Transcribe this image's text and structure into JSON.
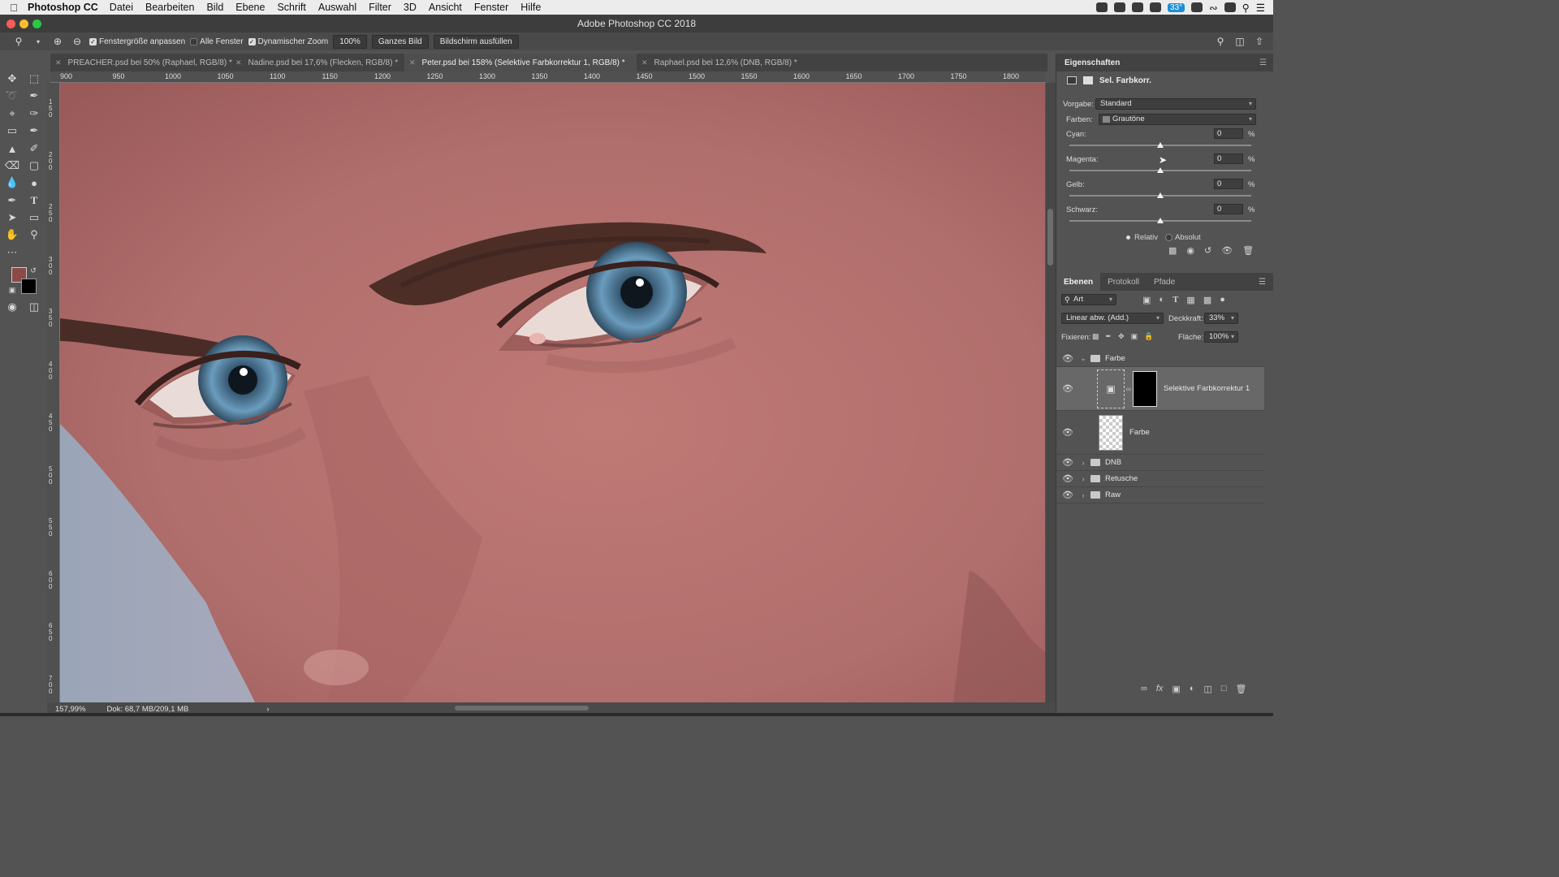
{
  "menubar": {
    "app_name": "Photoshop CC",
    "items": [
      "Datei",
      "Bearbeiten",
      "Bild",
      "Ebene",
      "Schrift",
      "Auswahl",
      "Filter",
      "3D",
      "Ansicht",
      "Fenster",
      "Hilfe"
    ],
    "battery_badge": "33°"
  },
  "window": {
    "title": "Adobe Photoshop CC 2018"
  },
  "options": {
    "resize_windows": "Fenstergröße anpassen",
    "all_windows": "Alle Fenster",
    "scrubby_zoom": "Dynamischer Zoom",
    "zoom_100": "100%",
    "fit_screen": "Ganzes Bild",
    "fill_screen": "Bildschirm ausfüllen"
  },
  "tabs": [
    {
      "label": "PREACHER.psd bei 50% (Raphael, RGB/8) *"
    },
    {
      "label": "Nadine.psd bei 17,6% (Flecken, RGB/8) *"
    },
    {
      "label": "Peter.psd bei 158% (Selektive Farbkorrektur 1, RGB/8) *"
    },
    {
      "label": "Raphael.psd bei 12,6% (DNB, RGB/8) *"
    }
  ],
  "ruler_top": [
    "900",
    "950",
    "1000",
    "1050",
    "1100",
    "1150",
    "1200",
    "1250",
    "1300",
    "1350",
    "1400",
    "1450",
    "1500",
    "1550",
    "1600",
    "1650",
    "1700",
    "1750",
    "1800"
  ],
  "ruler_left": [
    "150",
    "200",
    "250",
    "300",
    "350",
    "400",
    "450",
    "500",
    "550",
    "600",
    "650",
    "700"
  ],
  "status": {
    "zoom": "157,99%",
    "doc": "Dok: 68,7 MB/209,1 MB",
    "arrow": "›"
  },
  "properties": {
    "title": "Eigenschaften",
    "adj_name": "Sel. Farbkorr.",
    "preset_label": "Vorgabe:",
    "preset_value": "Standard",
    "colors_label": "Farben:",
    "colors_value": "Grautöne",
    "sliders": [
      {
        "label": "Cyan:",
        "value": "0",
        "unit": "%"
      },
      {
        "label": "Magenta:",
        "value": "0",
        "unit": "%"
      },
      {
        "label": "Gelb:",
        "value": "0",
        "unit": "%"
      },
      {
        "label": "Schwarz:",
        "value": "0",
        "unit": "%"
      }
    ],
    "relative": "Relativ",
    "absolute": "Absolut"
  },
  "layers_panel": {
    "tabs": [
      "Ebenen",
      "Protokoll",
      "Pfade"
    ],
    "filter": "Art",
    "blend_mode": "Linear abw. (Add.)",
    "opacity_label": "Deckkraft:",
    "opacity_value": "33%",
    "lock_label": "Fixieren:",
    "fill_label": "Fläche:",
    "fill_value": "100%",
    "layers": [
      {
        "name": "Farbe",
        "kind": "group-open"
      },
      {
        "name": "Selektive Farbkorrektur 1",
        "kind": "adjustment"
      },
      {
        "name": "Farbe",
        "kind": "pixel"
      },
      {
        "name": "DNB",
        "kind": "group"
      },
      {
        "name": "Retusche",
        "kind": "group"
      },
      {
        "name": "Raw",
        "kind": "group"
      }
    ]
  },
  "colors": {
    "foreground": "#8b4a48",
    "background": "#000000",
    "skin": "#b06e6c",
    "iris": "#5a8eb0"
  }
}
